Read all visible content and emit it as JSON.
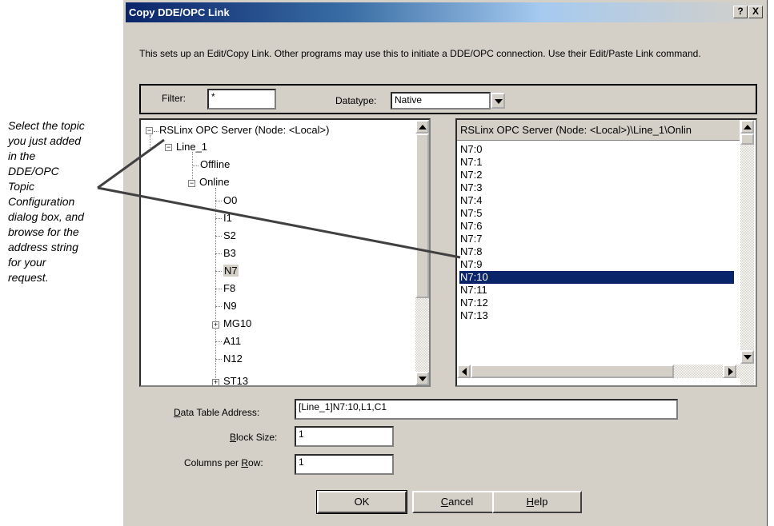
{
  "annotation": {
    "lines": [
      "Select the topic",
      "you just added",
      "in the",
      "DDE/OPC",
      "Topic",
      "Configuration",
      "dialog box, and",
      "browse for the",
      "address string",
      "for your",
      "request."
    ]
  },
  "dialog": {
    "title": "Copy DDE/OPC Link",
    "help_btn": "?",
    "close_btn": "X",
    "description": "This sets up an Edit/Copy Link.  Other programs may use this to initiate a DDE/OPC connection.  Use their Edit/Paste Link command.",
    "filter_label": "Filter:",
    "filter_value": "*",
    "datatype_label": "Datatype:",
    "datatype_value": "Native",
    "tree": {
      "root": "RSLinx OPC Server (Node: <Local>)",
      "line": "Line_1",
      "offline": "Offline",
      "online": "Online",
      "children": [
        "O0",
        "I1",
        "S2",
        "B3",
        "N7",
        "F8",
        "N9",
        "MG10",
        "A11",
        "N12",
        "ST13"
      ]
    },
    "list": {
      "header": "RSLinx OPC Server (Node: <Local>)\\Line_1\\Onlin",
      "items": [
        "N7:0",
        "N7:1",
        "N7:2",
        "N7:3",
        "N7:4",
        "N7:5",
        "N7:6",
        "N7:7",
        "N7:8",
        "N7:9",
        "N7:10",
        "N7:11",
        "N7:12",
        "N7:13"
      ],
      "selected": "N7:10"
    },
    "address_label_u": "D",
    "address_label_rest": "ata Table Address:",
    "address_value": "[Line_1]N7:10,L1,C1",
    "blocksize_label_u": "B",
    "blocksize_label_rest": "lock Size:",
    "blocksize_value": "1",
    "columns_label_pre": "Columns per ",
    "columns_label_u": "R",
    "columns_label_rest": "ow:",
    "columns_value": "1",
    "ok_label": "OK",
    "cancel_u": "C",
    "cancel_rest": "ancel",
    "help_u": "H",
    "help_rest": "elp"
  },
  "colors": {
    "selection": "#0a246a",
    "face": "#d4d0c8"
  }
}
